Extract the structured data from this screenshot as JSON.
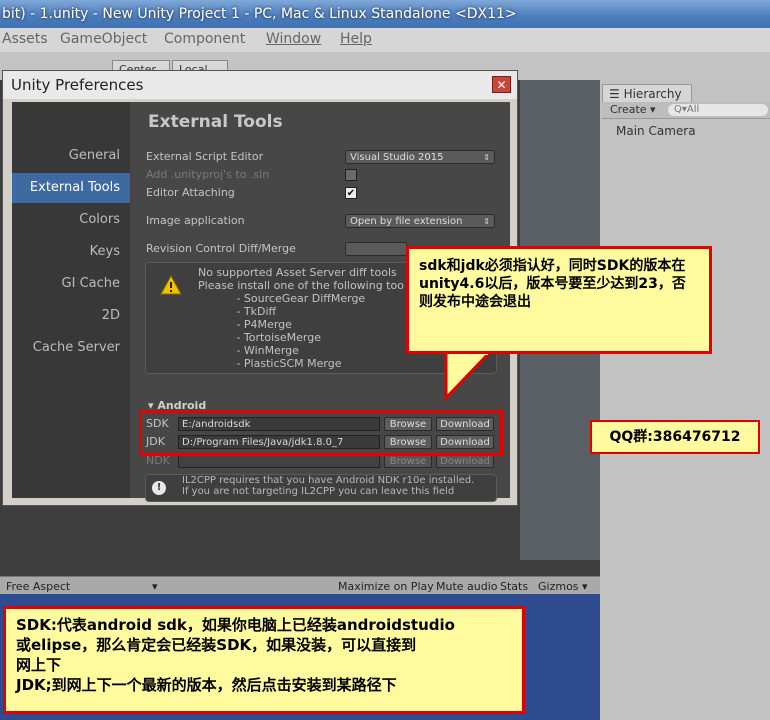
{
  "window": {
    "title": "bit) - 1.unity - New Unity Project 1 - PC, Mac & Linux Standalone <DX11>"
  },
  "menubar": {
    "items": [
      "Assets",
      "GameObject",
      "Component",
      "Window",
      "Help"
    ]
  },
  "toolbar": {
    "center_label": "Center",
    "local_label": "Local"
  },
  "hierarchy": {
    "tab_label": "Hierarchy",
    "create_label": "Create ▾",
    "search_placeholder": "Q▾All",
    "items": [
      "Main Camera"
    ]
  },
  "game_view": {
    "aspect_label": "Free Aspect",
    "maximize_label": "Maximize on Play",
    "mute_label": "Mute audio",
    "stats_label": "Stats",
    "gizmos_label": "Gizmos ▾"
  },
  "preferences": {
    "title": "Unity Preferences",
    "close_label": "✕",
    "nav": [
      "General",
      "External Tools",
      "Colors",
      "Keys",
      "GI Cache",
      "2D",
      "Cache Server"
    ],
    "selected_nav": "External Tools",
    "section_title": "External Tools",
    "script_editor_label": "External Script Editor",
    "script_editor_value": "Visual Studio 2015",
    "add_unityproj_label": "Add .unityproj's to .sln",
    "editor_attaching_label": "Editor Attaching",
    "image_app_label": "Image application",
    "image_app_value": "Open by file extension",
    "revision_label": "Revision Control Diff/Merge",
    "revision_value": "",
    "warning_lines": [
      "No supported Asset Server diff tools",
      "Please install one of the following too",
      "           - SourceGear DiffMerge",
      "           - TkDiff",
      "           - P4Merge",
      "           - TortoiseMerge",
      "           - WinMerge",
      "           - PlasticSCM Merge"
    ],
    "android_header": "Android",
    "sdk_label": "SDK",
    "sdk_value": "E:/androidsdk",
    "jdk_label": "JDK",
    "jdk_value": "D:/Program Files/Java/jdk1.8.0_7",
    "ndk_label": "NDK",
    "ndk_value": "",
    "browse_label": "Browse",
    "download_label": "Download",
    "il2cpp_lines": [
      "IL2CPP requires that you have Android NDK r10e installed.",
      "If you are not targeting IL2CPP you can leave this field"
    ]
  },
  "annotations": {
    "callout_text": "sdk和jdk必须指认好，同时SDK的版本在unity4.6以后，版本号要至少达到23，否则发布中途会退出",
    "qq_text": "QQ群:386476712",
    "note_lines": [
      "SDK:代表android sdk，如果你电脑上已经装androidstudio",
      "或elipse，那么肯定会已经装SDK，如果没装，可以直接到",
      "网上下",
      "JDK;到网上下一个最新的版本，然后点击安装到某路径下"
    ]
  },
  "colors": {
    "highlight": "#e00000",
    "note_bg": "#fffa9e",
    "selected_nav": "#3e6aa1"
  }
}
